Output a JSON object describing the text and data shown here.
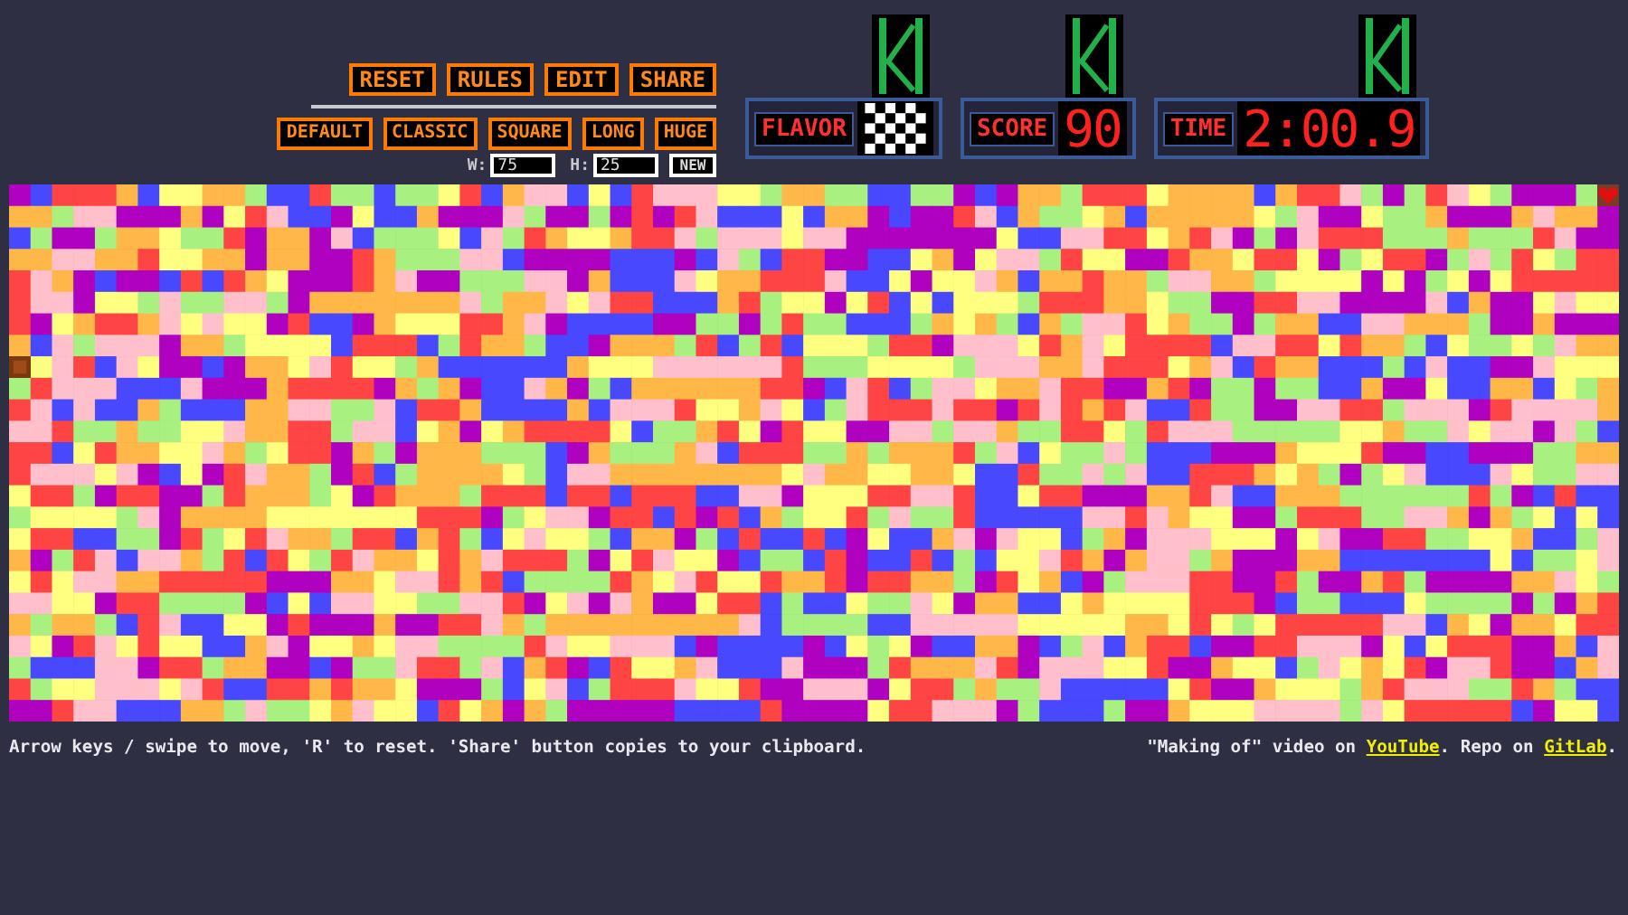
{
  "top_buttons": [
    "RESET",
    "RULES",
    "EDIT",
    "SHARE"
  ],
  "size_presets": [
    "DEFAULT",
    "CLASSIC",
    "SQUARE",
    "LONG",
    "HUGE"
  ],
  "width_field": {
    "label": "W:",
    "value": "75"
  },
  "height_field": {
    "label": "H:",
    "value": "25"
  },
  "new_button": "NEW",
  "stats": [
    {
      "label": "FLAVOR",
      "kind": "flag"
    },
    {
      "label": "SCORE",
      "kind": "value",
      "value": "90"
    },
    {
      "label": "TIME",
      "kind": "value",
      "value": "2:00.9"
    }
  ],
  "footer": {
    "help": "Arrow keys / swipe to move, 'R' to reset. 'Share' button copies to your clipboard.",
    "credits": [
      {
        "kind": "text",
        "text": "\"Making of\" video on "
      },
      {
        "kind": "link",
        "text": "YouTube"
      },
      {
        "kind": "text",
        "text": ". Repo on "
      },
      {
        "kind": "link",
        "text": "GitLab"
      },
      {
        "kind": "text",
        "text": "."
      }
    ]
  }
}
